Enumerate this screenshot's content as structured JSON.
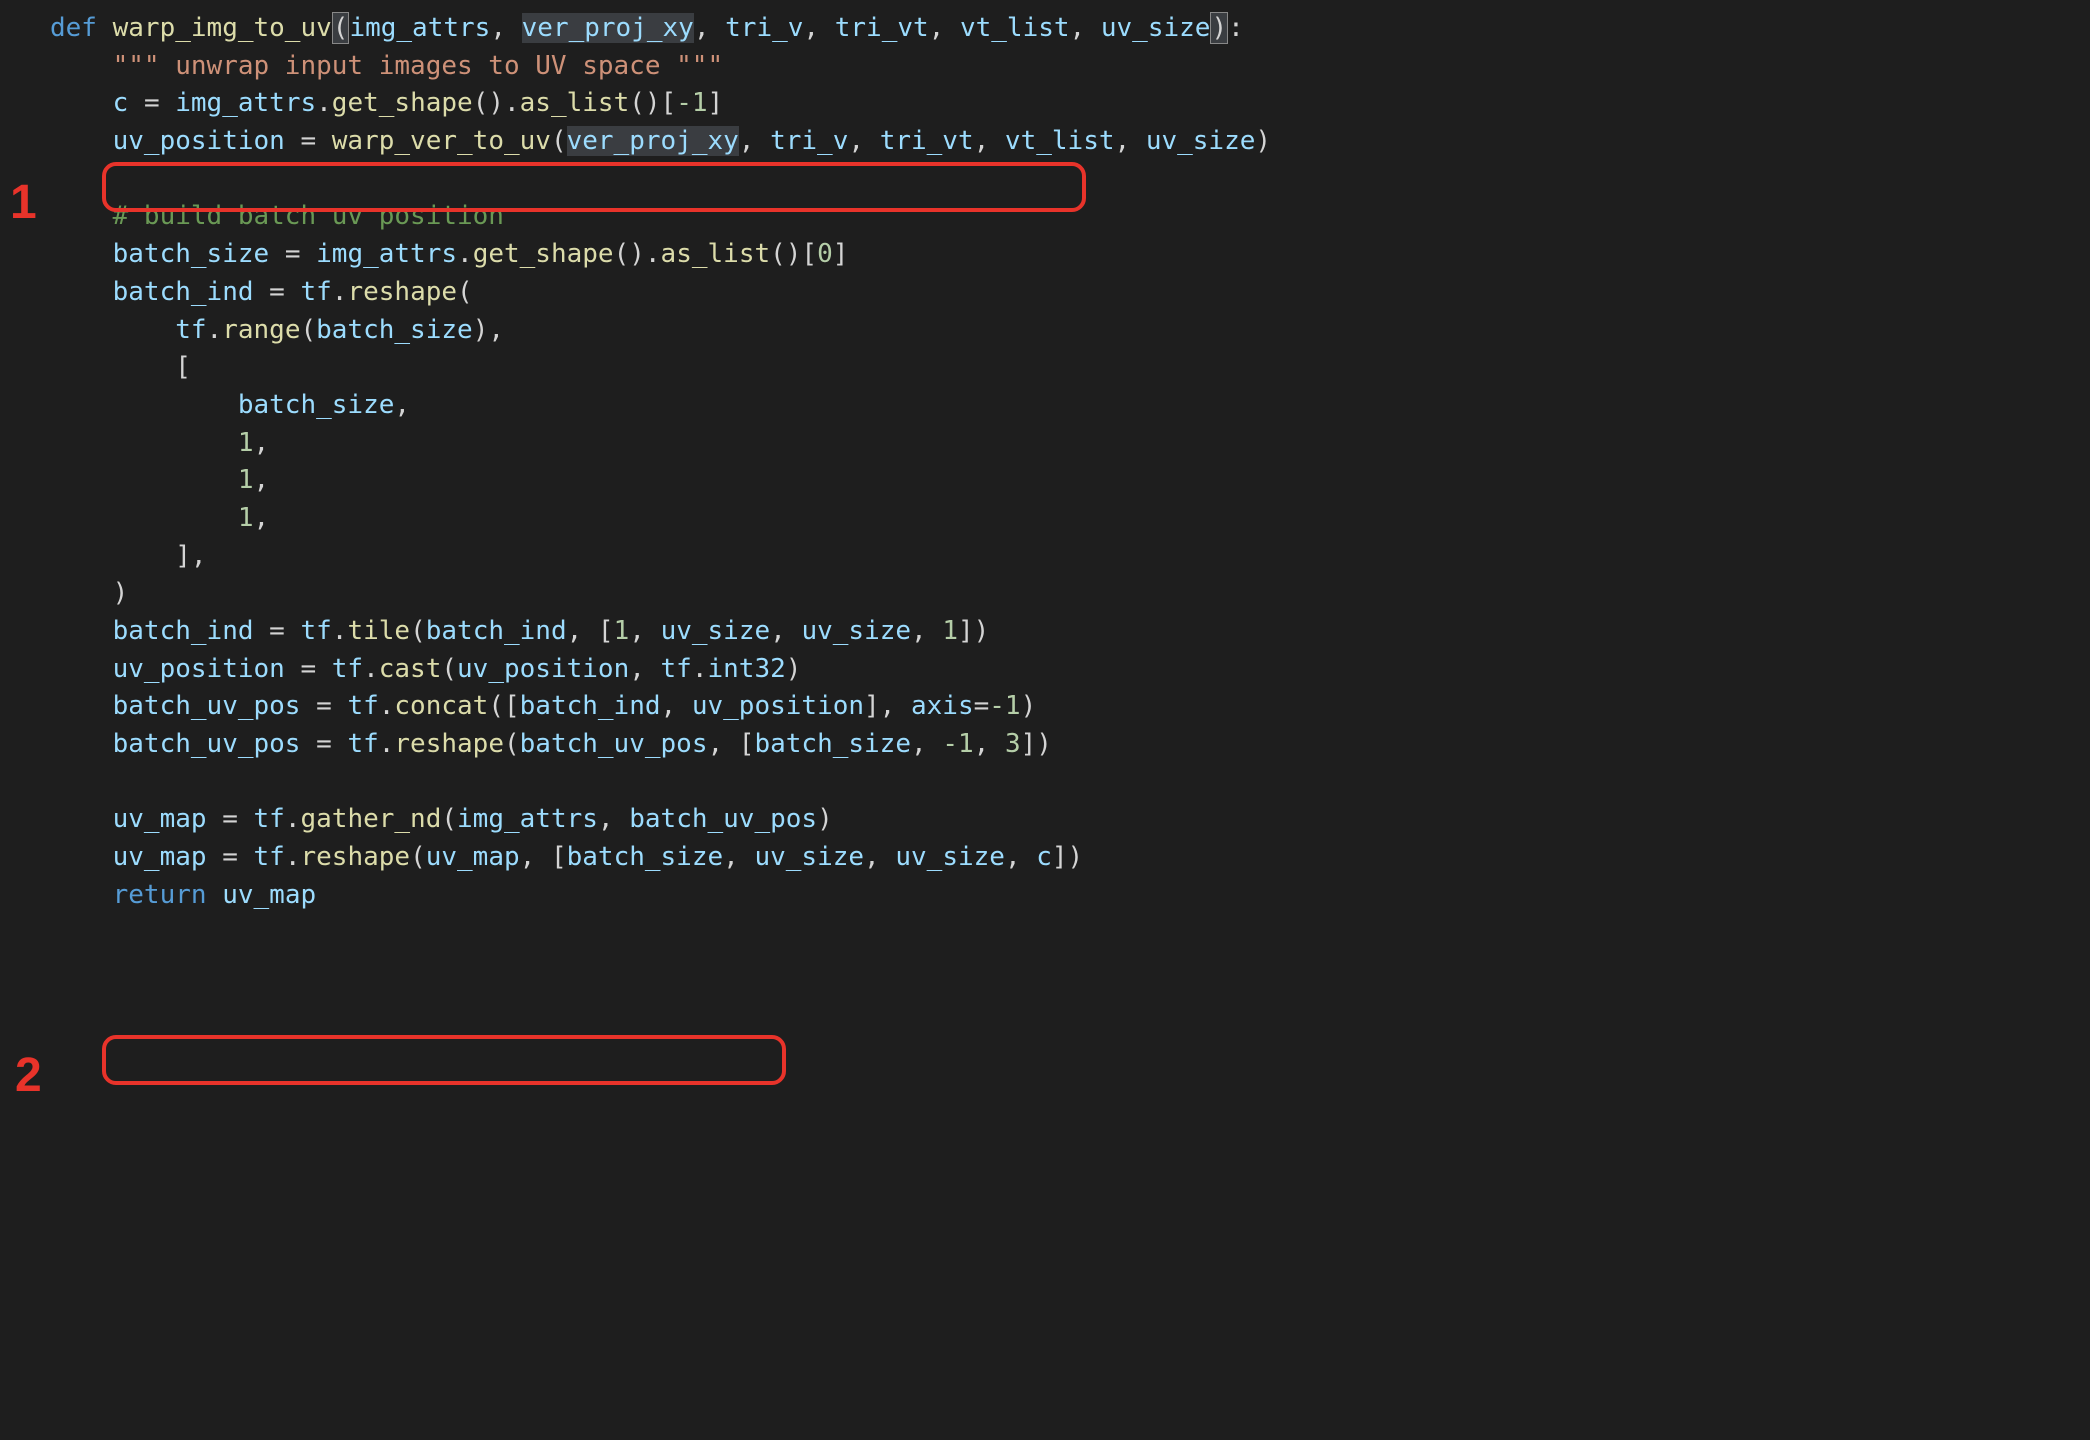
{
  "annotations": {
    "label1": "1",
    "label2": "2"
  },
  "code": {
    "l1": {
      "def": "def",
      "fname": "warp_img_to_uv",
      "p1": "img_attrs",
      "p2": "ver_proj_xy",
      "p3": "tri_v",
      "p4": "tri_vt",
      "p5": "vt_list",
      "p6": "uv_size"
    },
    "l2": {
      "docstring": "\"\"\" unwrap input images to UV space \"\"\""
    },
    "l3": {
      "var": "c",
      "expr1": "img_attrs",
      "m1": "get_shape",
      "m2": "as_list",
      "idx": "-1"
    },
    "l4": {
      "var": "uv_position",
      "fn": "warp_ver_to_uv",
      "a1": "ver_proj_xy",
      "a2": "tri_v",
      "a3": "tri_vt",
      "a4": "vt_list",
      "a5": "uv_size"
    },
    "l6": {
      "comment": "# build batch uv position"
    },
    "l7": {
      "var": "batch_size",
      "expr1": "img_attrs",
      "m1": "get_shape",
      "m2": "as_list",
      "idx": "0"
    },
    "l8": {
      "var": "batch_ind",
      "mod": "tf",
      "fn": "reshape"
    },
    "l9": {
      "mod": "tf",
      "fn": "range",
      "arg": "batch_size"
    },
    "l11": {
      "arg": "batch_size"
    },
    "l12": {
      "num": "1"
    },
    "l13": {
      "num": "1"
    },
    "l14": {
      "num": "1"
    },
    "l17": {
      "var": "batch_ind",
      "mod": "tf",
      "fn": "tile",
      "a1": "batch_ind",
      "n1": "1",
      "a2": "uv_size",
      "a3": "uv_size",
      "n2": "1"
    },
    "l18": {
      "var": "uv_position",
      "mod": "tf",
      "fn": "cast",
      "a1": "uv_position",
      "a2mod": "tf",
      "a2": "int32"
    },
    "l19": {
      "var": "batch_uv_pos",
      "mod": "tf",
      "fn": "concat",
      "a1": "batch_ind",
      "a2": "uv_position",
      "kw": "axis",
      "kv": "-1"
    },
    "l20": {
      "var": "batch_uv_pos",
      "mod": "tf",
      "fn": "reshape",
      "a1": "batch_uv_pos",
      "a2": "batch_size",
      "n1": "-1",
      "n2": "3"
    },
    "l22": {
      "var": "uv_map",
      "mod": "tf",
      "fn": "gather_nd",
      "a1": "img_attrs",
      "a2": "batch_uv_pos"
    },
    "l23": {
      "var": "uv_map",
      "mod": "tf",
      "fn": "reshape",
      "a1": "uv_map",
      "a2": "batch_size",
      "a3": "uv_size",
      "a4": "uv_size",
      "a5": "c"
    },
    "l24": {
      "kw": "return",
      "var": "uv_map"
    }
  }
}
